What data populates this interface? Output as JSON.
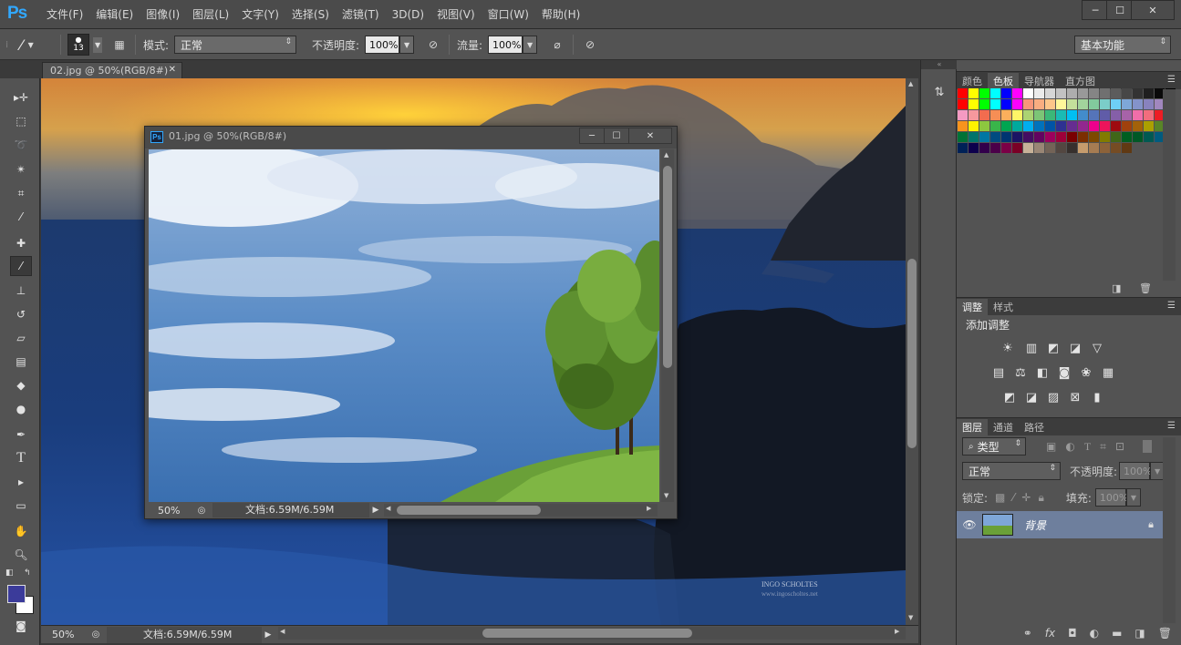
{
  "app": {
    "logo": "Ps",
    "menu": [
      "文件(F)",
      "编辑(E)",
      "图像(I)",
      "图层(L)",
      "文字(Y)",
      "选择(S)",
      "滤镜(T)",
      "3D(D)",
      "视图(V)",
      "窗口(W)",
      "帮助(H)"
    ],
    "window_controls": [
      "─",
      "☐",
      "✕"
    ]
  },
  "options": {
    "brush_size": "13",
    "mode_label": "模式:",
    "mode_value": "正常",
    "opacity_label": "不透明度:",
    "opacity_value": "100%",
    "flow_label": "流量:",
    "flow_value": "100%",
    "workspace": "基本功能"
  },
  "document": {
    "tab_title": "02.jpg @ 50%(RGB/8#)",
    "zoom": "50%",
    "doc_info": "文档:6.59M/6.59M",
    "watermark_line1": "INGO SCHOLTES",
    "watermark_line2": "www.ingoscholtes.net"
  },
  "floating_window": {
    "title": "01.jpg @ 50%(RGB/8#)",
    "zoom": "50%",
    "doc_info": "文档:6.59M/6.59M"
  },
  "panels": {
    "color_tabs": [
      "颜色",
      "色板",
      "导航器",
      "直方图"
    ],
    "color_active": "色板",
    "adjust_tabs": [
      "调整",
      "样式"
    ],
    "adjust_active": "调整",
    "adjust_title": "添加调整",
    "layers_tabs": [
      "图层",
      "通道",
      "路径"
    ],
    "layers_active": "图层",
    "filter_kind": "类型",
    "blend_mode": "正常",
    "opacity_label": "不透明度:",
    "opacity_value": "100%",
    "lock_label": "锁定:",
    "fill_label": "填充:",
    "fill_value": "100%",
    "layer_name": "背景"
  },
  "colors": {
    "foreground": "#3b3b9a",
    "background": "#ffffff",
    "accent": "#31a8ff",
    "selected_layer": "#6e7f9d",
    "swatch_rows": [
      [
        "#ff0000",
        "#ffff00",
        "#00ff00",
        "#00ffff",
        "#0000ff",
        "#ff00ff",
        "#ffffff",
        "#ebebeb",
        "#d6d6d6",
        "#c2c2c2",
        "#adadad",
        "#999999",
        "#858585",
        "#707070",
        "#5c5c5c",
        "#474747",
        "#333333",
        "#1f1f1f",
        "#0a0a0a",
        "#000000"
      ],
      [
        "#ff0000",
        "#ffff00",
        "#00ff00",
        "#00ffff",
        "#0000ff",
        "#ff00ff",
        "#f7977a",
        "#f9ad81",
        "#fdc68a",
        "#fff79a",
        "#c4df9b",
        "#a2d39c",
        "#82ca9d",
        "#7bcdc8",
        "#6ecff6",
        "#7ea7d8",
        "#8493ca",
        "#8882be",
        "#a187be",
        "#bc8dbf"
      ],
      [
        "#f49ac2",
        "#f6989d",
        "#f26c4f",
        "#f68e55",
        "#fbaf5c",
        "#fff467",
        "#acd372",
        "#7cc576",
        "#3bb878",
        "#1abbb4",
        "#00bff3",
        "#438ccb",
        "#5574b9",
        "#605ca8",
        "#855fa8",
        "#a763a8",
        "#f06ea9",
        "#f26d7d",
        "#ed1c24",
        "#f26522"
      ],
      [
        "#f7941d",
        "#fff200",
        "#8dc73f",
        "#39b54a",
        "#00a651",
        "#00a99d",
        "#00aeef",
        "#0072bc",
        "#0054a6",
        "#2e3192",
        "#662d91",
        "#92278f",
        "#ec008c",
        "#ed145b",
        "#9e0b0f",
        "#a0410d",
        "#a36209",
        "#aba000",
        "#598527",
        "#197b30"
      ],
      [
        "#007236",
        "#00746b",
        "#0076a3",
        "#004b80",
        "#003471",
        "#1b1464",
        "#440e62",
        "#630460",
        "#9e005d",
        "#9e0039",
        "#790000",
        "#7b2e00",
        "#7d4900",
        "#827b00",
        "#406618",
        "#005e20",
        "#005826",
        "#005952",
        "#005b7f",
        "#003663"
      ],
      [
        "#002157",
        "#0d004c",
        "#32004b",
        "#4b0049",
        "#7b0046",
        "#7a0026",
        "#c7b299",
        "#998675",
        "#736357",
        "#534741",
        "#37302d",
        "#c69c6d",
        "#a67c52",
        "#8c6239",
        "#754c24",
        "#603913"
      ]
    ]
  }
}
